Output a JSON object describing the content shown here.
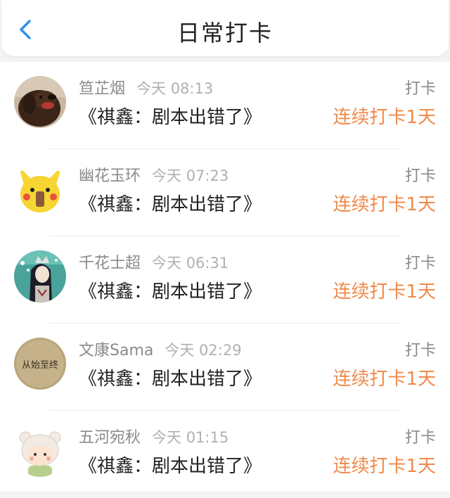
{
  "header": {
    "title": "日常打卡",
    "back_icon": "chevron-left-icon",
    "accent_color": "#2f8ff0"
  },
  "streak_color": "#f08a4b",
  "items": [
    {
      "name": "笪芷烟",
      "time": "今天 08:13",
      "content": "《祺鑫：剧本出错了》",
      "label": "打卡",
      "streak": "连续打卡1天",
      "avatar": "dog-avatar"
    },
    {
      "name": "幽花玉环",
      "time": "今天 07:23",
      "content": "《祺鑫：剧本出错了》",
      "label": "打卡",
      "streak": "连续打卡1天",
      "avatar": "pikachu-avatar"
    },
    {
      "name": "千花士超",
      "time": "今天 06:31",
      "content": "《祺鑫：剧本出错了》",
      "label": "打卡",
      "streak": "连续打卡1天",
      "avatar": "anime-girl-avatar"
    },
    {
      "name": "文康Sama",
      "time": "今天 02:29",
      "content": "《祺鑫：剧本出错了》",
      "label": "打卡",
      "streak": "连续打卡1天",
      "avatar": "text-avatar",
      "avatar_text": "从始至终"
    },
    {
      "name": "五河宛秋",
      "time": "今天 01:15",
      "content": "《祺鑫：剧本出错了》",
      "label": "打卡",
      "streak": "连续打卡1天",
      "avatar": "bear-hat-avatar"
    }
  ]
}
